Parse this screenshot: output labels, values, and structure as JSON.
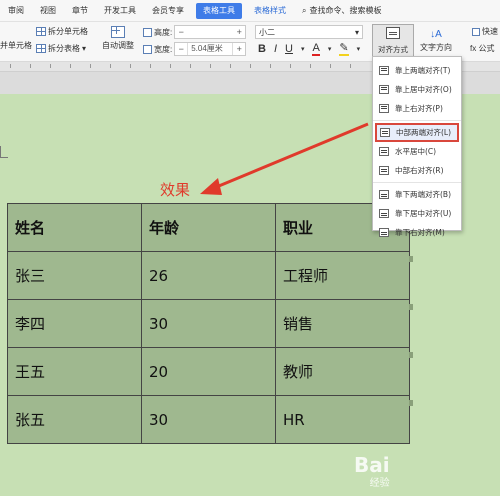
{
  "menubar": {
    "tabs": [
      "审阅",
      "视图",
      "章节",
      "开发工具",
      "会员专享",
      "表格工具",
      "表格样式"
    ],
    "active_tab": "表格工具",
    "search_text": "查找命令、搜索模板"
  },
  "toolbar": {
    "merge_label": "并单元格",
    "split_cell": "拆分单元格",
    "split_table": "拆分表格",
    "auto_adjust": "自动调整",
    "height_label": "高度:",
    "height_value": "",
    "width_label": "宽度:",
    "width_value": "5.04厘米",
    "font_size": "小二",
    "align_button": "对齐方式",
    "text_direction": "文字方向",
    "quick_calc": "快速",
    "formula": "fx 公式"
  },
  "align_menu": {
    "items": [
      {
        "label": "靠上两端对齐(T)",
        "icon": "align-top-justify-icon"
      },
      {
        "label": "靠上居中对齐(O)",
        "icon": "align-top-center-icon"
      },
      {
        "label": "靠上右对齐(P)",
        "icon": "align-top-right-icon"
      },
      {
        "label": "中部两端对齐(L)",
        "icon": "align-middle-justify-icon"
      },
      {
        "label": "水平居中(C)",
        "icon": "align-middle-center-icon"
      },
      {
        "label": "中部右对齐(R)",
        "icon": "align-middle-right-icon"
      },
      {
        "label": "靠下两端对齐(B)",
        "icon": "align-bottom-justify-icon"
      },
      {
        "label": "靠下居中对齐(U)",
        "icon": "align-bottom-center-icon"
      },
      {
        "label": "靠下右对齐(M)",
        "icon": "align-bottom-right-icon"
      }
    ],
    "selected": "中部两端对齐(L)"
  },
  "annotation": {
    "label": "效果",
    "color": "#e03a2b"
  },
  "table": {
    "headers": [
      "姓名",
      "年龄",
      "职业"
    ],
    "rows": [
      [
        "张三",
        "26",
        "工程师"
      ],
      [
        "李四",
        "30",
        "销售"
      ],
      [
        "王五",
        "20",
        "教师"
      ],
      [
        "张五",
        "30",
        "HR"
      ]
    ]
  },
  "watermark": {
    "text": "Bai",
    "sub": "经验"
  }
}
